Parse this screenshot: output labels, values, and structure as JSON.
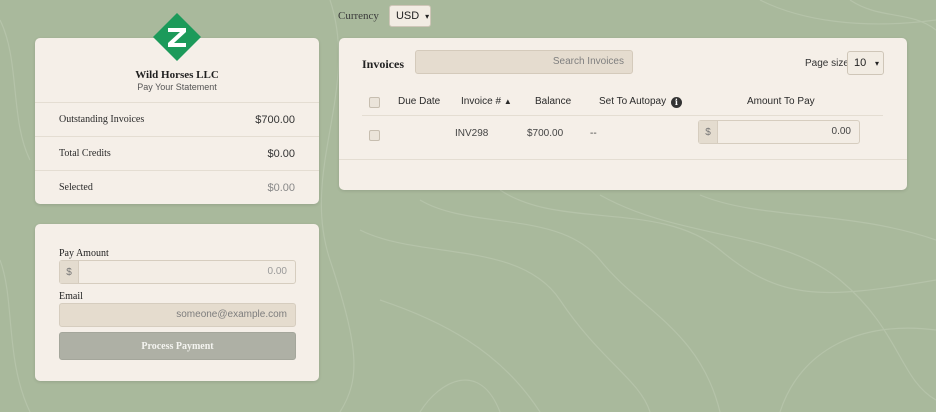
{
  "currency": {
    "label": "Currency",
    "selected": "USD"
  },
  "company": {
    "name": "Wild Horses LLC",
    "subtitle": "Pay Your Statement"
  },
  "summary": [
    {
      "label": "Outstanding Invoices",
      "value": "$700.00"
    },
    {
      "label": "Total Credits",
      "value": "$0.00"
    },
    {
      "label": "Selected",
      "value": "$0.00"
    }
  ],
  "payment": {
    "pay_amount_label": "Pay Amount",
    "currency_symbol": "$",
    "pay_amount_value": "0.00",
    "email_label": "Email",
    "email_placeholder": "someone@example.com",
    "process_button": "Process Payment"
  },
  "invoices": {
    "title": "Invoices",
    "search_placeholder": "Search Invoices",
    "page_size_label": "Page size",
    "page_size": "10",
    "columns": [
      "Due Date",
      "Invoice #",
      "Balance",
      "Set To Autopay",
      "Amount To Pay"
    ],
    "sort_indicator": "▲",
    "rows": [
      {
        "due_date": "",
        "invoice": "INV298",
        "balance": "$700.00",
        "autopay": "--",
        "currency_symbol": "$",
        "amount_to_pay": "0.00"
      }
    ]
  },
  "icons": {
    "logo": "company-logo",
    "info": "info-icon",
    "dropdown": "chevron-down-icon"
  },
  "colors": {
    "background": "#a9b99c",
    "card": "#f5efe8",
    "logo_green": "#1c9a5a",
    "button_disabled": "#aeb0a5"
  }
}
